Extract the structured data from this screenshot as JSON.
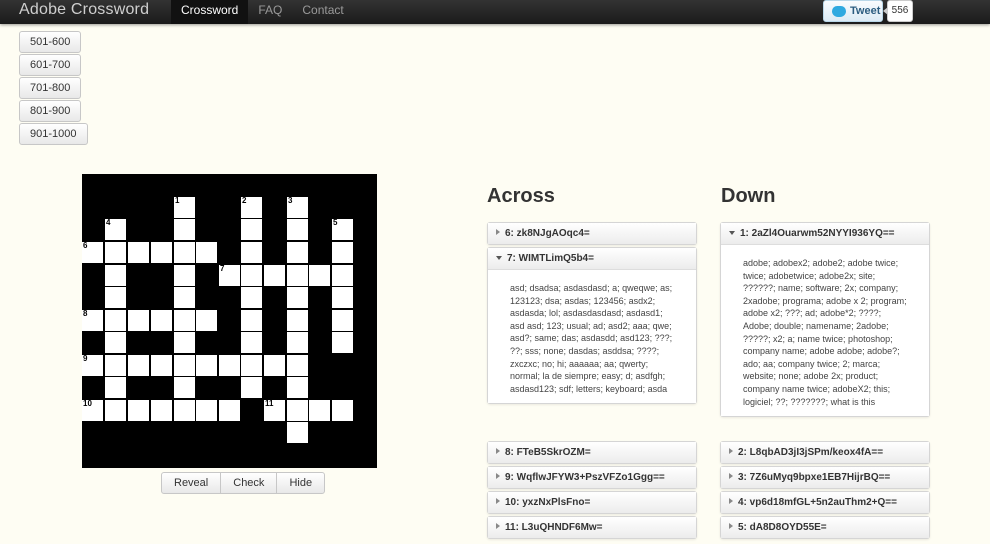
{
  "navbar": {
    "brand": "Adobe Crossword",
    "links": [
      "Crossword",
      "FAQ",
      "Contact"
    ],
    "tweet_label": "Tweet",
    "tweet_count": "556"
  },
  "ranges": [
    "501-600",
    "601-700",
    "701-800",
    "801-900",
    "901-1000"
  ],
  "board": {
    "numbers": [
      "1",
      "2",
      "3",
      "4",
      "5",
      "6",
      "7",
      "8",
      "9",
      "10",
      "11"
    ]
  },
  "controls": {
    "reveal": "Reveal",
    "check": "Check",
    "hide": "Hide"
  },
  "across": {
    "title": "Across",
    "clues": [
      {
        "label": "6: zk8NJgAOqc4=",
        "expanded": false
      },
      {
        "label": "7: WIMTLimQ5b4=",
        "expanded": true,
        "text": "asd; dsadsa; asdasdasd; a; qweqwe; as; 123123; dsa; asdas; 123456; asdx2; asdasda; lol; asdasdasdasd; asdasd1; asd asd; 123; usual; ad; asd2; aaa; qwe; asd?; same; das; asdasdd; asd123; ???; ??; sss; none; dasdas; asddsa; ????; zxczxc; no; hi; aaaaaa; aa; qwerty; normal; la de siempre; easy; d; asdfgh; asdasd123; sdf; letters; keyboard; asda"
      },
      {
        "label": "8: FTeB5SkrOZM=",
        "expanded": false
      },
      {
        "label": "9: WqflwJFYW3+PszVFZo1Ggg==",
        "expanded": false
      },
      {
        "label": "10: yxzNxPlsFno=",
        "expanded": false
      },
      {
        "label": "11: L3uQHNDF6Mw=",
        "expanded": false
      }
    ]
  },
  "down": {
    "title": "Down",
    "clues": [
      {
        "label": "1: 2aZl4Ouarwm52NYYI936YQ==",
        "expanded": true,
        "text": "adobe; adobex2; adobe2; adobe twice; twice; adobetwice; adobe2x; site; ??????; name; software; 2x; company; 2xadobe; programa; adobe x 2; program; adobe x2; ???; ad; adobe*2; ????; Adobe; double; namename; 2adobe; ?????; x2; a; name twice; photoshop; company name; adobe adobe; adobe?; ado; aa; company twice; 2; marca; website; none; adobe 2x; product; company name twice; adobeX2; this; logiciel; ??; ???????; what is this"
      },
      {
        "label": "2: L8qbAD3jI3jSPm/keox4fA==",
        "expanded": false
      },
      {
        "label": "3: 7Z6uMyq9bpxe1EB7HijrBQ==",
        "expanded": false
      },
      {
        "label": "4: vp6d18mfGL+5n2auThm2+Q==",
        "expanded": false
      },
      {
        "label": "5: dA8D8OYD55E=",
        "expanded": false
      }
    ]
  }
}
